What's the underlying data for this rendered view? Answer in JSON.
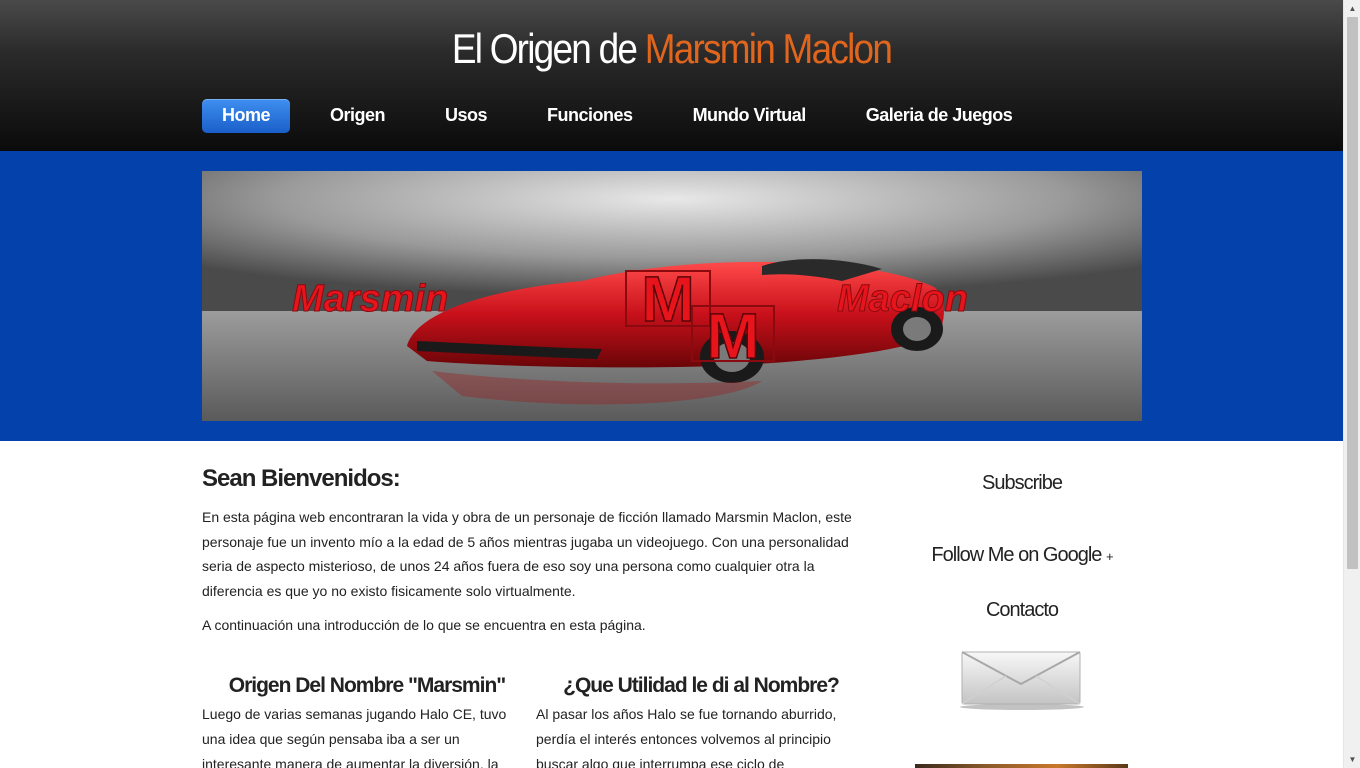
{
  "site": {
    "title_part1": "El Origen de ",
    "title_part2": "Marsmin Maclon"
  },
  "nav": {
    "items": [
      {
        "label": "Home",
        "active": true
      },
      {
        "label": "Origen",
        "active": false
      },
      {
        "label": "Usos",
        "active": false
      },
      {
        "label": "Funciones",
        "active": false
      },
      {
        "label": "Mundo Virtual",
        "active": false
      },
      {
        "label": "Galeria de Juegos",
        "active": false
      }
    ]
  },
  "banner": {
    "left_text": "Marsmin",
    "right_text": "Maclon",
    "logo_top": "M",
    "logo_bottom": "M"
  },
  "main": {
    "welcome_title": "Sean Bienvenidos:",
    "paragraph1": "En esta página web encontraran la vida y obra de un personaje de ficción llamado Marsmin Maclon, este personaje fue un invento mío a la edad de 5 años mientras jugaba un videojuego. Con una personalidad seria de aspecto misterioso, de unos 24 años fuera de eso soy una persona como cualquier otra la diferencia es que yo no existo fisicamente solo virtualmente.",
    "paragraph2": "A continuación una introducción de lo que se encuentra en esta página.",
    "col1_title": "Origen Del Nombre \"Marsmin\"",
    "col1_text": "Luego de varias semanas jugando Halo CE, tuvo una idea que según pensaba iba a ser un interesante manera de aumentar la diversión, la",
    "col2_title": "¿Que Utilidad le di al Nombre?",
    "col2_text": "Al pasar los años Halo se fue tornando aburrido, perdía el interés entonces volvemos al principio buscar algo que interrumpa ese ciclo de"
  },
  "sidebar": {
    "subscribe": "Subscribe",
    "follow": "Follow Me on Google",
    "follow_plus": "+",
    "contact": "Contacto"
  },
  "colors": {
    "accent_orange": "#e0651d",
    "banner_blue": "#0541aa",
    "nav_active": "#2a78e0",
    "banner_text_red": "#e8141c"
  },
  "icons": [
    "envelope-icon",
    "scroll-up-icon",
    "scroll-down-icon"
  ]
}
